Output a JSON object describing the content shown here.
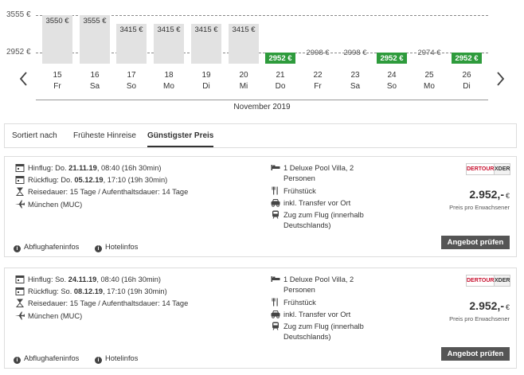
{
  "chart_data": {
    "type": "bar",
    "y_ticks": [
      "3555 €",
      "2952 €"
    ],
    "ylim": [
      2600,
      3555
    ],
    "month": "November 2019",
    "days": [
      {
        "day": "15",
        "weekday": "Fr",
        "price": 3550,
        "label": "3550 €",
        "style": "bar"
      },
      {
        "day": "16",
        "weekday": "Sa",
        "price": 3555,
        "label": "3555 €",
        "style": "bar"
      },
      {
        "day": "17",
        "weekday": "So",
        "price": 3415,
        "label": "3415 €",
        "style": "bar"
      },
      {
        "day": "18",
        "weekday": "Mo",
        "price": 3415,
        "label": "3415 €",
        "style": "bar"
      },
      {
        "day": "19",
        "weekday": "Di",
        "price": 3415,
        "label": "3415 €",
        "style": "bar"
      },
      {
        "day": "20",
        "weekday": "Mi",
        "price": 3415,
        "label": "3415 €",
        "style": "bar"
      },
      {
        "day": "21",
        "weekday": "Do",
        "price": 2952,
        "label": "2952 €",
        "style": "best"
      },
      {
        "day": "22",
        "weekday": "Fr",
        "price": 2998,
        "label": "2998 €",
        "style": "text"
      },
      {
        "day": "23",
        "weekday": "Sa",
        "price": 2998,
        "label": "2998 €",
        "style": "text"
      },
      {
        "day": "24",
        "weekday": "So",
        "price": 2952,
        "label": "2952 €",
        "style": "best"
      },
      {
        "day": "25",
        "weekday": "Mo",
        "price": 2974,
        "label": "2974 €",
        "style": "text"
      },
      {
        "day": "26",
        "weekday": "Di",
        "price": 2952,
        "label": "2952 €",
        "style": "best"
      }
    ],
    "colors": {
      "bar": "#e2e2e2",
      "best": "#2e9b3c"
    }
  },
  "nav": {
    "prev_icon": "chevron-left-icon",
    "next_icon": "chevron-right-icon"
  },
  "sort": {
    "label": "Sortiert nach",
    "options": [
      "Früheste Hinreise",
      "Günstigster Preis"
    ],
    "active": "Günstigster Preis"
  },
  "offers": [
    {
      "outbound_prefix": "Hinflug: Do. ",
      "outbound_date": "21.11.19",
      "outbound_suffix": ", 08:40 (16h 30min)",
      "return_prefix": "Rückflug: Do. ",
      "return_date": "05.12.19",
      "return_suffix": ", 17:10 (19h 30min)",
      "duration": "Reisedauer: 15 Tage / Aufenthaltsdauer: 14 Tage",
      "airport": "München (MUC)",
      "room_line1": "1 Deluxe Pool Villa, 2",
      "room_line2": "Personen",
      "board": "Frühstück",
      "transfer": "inkl. Transfer vor Ort",
      "train_line1": "Zug zum Flug (innerhalb",
      "train_line2": "Deutschlands)",
      "operator_logo": "DERTOUR",
      "operator_sub": "XDER",
      "price": "2.952,-",
      "currency": "€",
      "price_note": "Preis pro Erwachsener",
      "cta": "Angebot prüfen",
      "airport_info": "Abflughafeninfos",
      "hotel_info": "Hotelinfos"
    },
    {
      "outbound_prefix": "Hinflug: So. ",
      "outbound_date": "24.11.19",
      "outbound_suffix": ", 08:40 (16h 30min)",
      "return_prefix": "Rückflug: So. ",
      "return_date": "08.12.19",
      "return_suffix": ", 17:10 (19h 30min)",
      "duration": "Reisedauer: 15 Tage / Aufenthaltsdauer: 14 Tage",
      "airport": "München (MUC)",
      "room_line1": "1 Deluxe Pool Villa, 2",
      "room_line2": "Personen",
      "board": "Frühstück",
      "transfer": "inkl. Transfer vor Ort",
      "train_line1": "Zug zum Flug (innerhalb",
      "train_line2": "Deutschlands)",
      "operator_logo": "DERTOUR",
      "operator_sub": "XDER",
      "price": "2.952,-",
      "currency": "€",
      "price_note": "Preis pro Erwachsener",
      "cta": "Angebot prüfen",
      "airport_info": "Abflughafeninfos",
      "hotel_info": "Hotelinfos"
    }
  ]
}
